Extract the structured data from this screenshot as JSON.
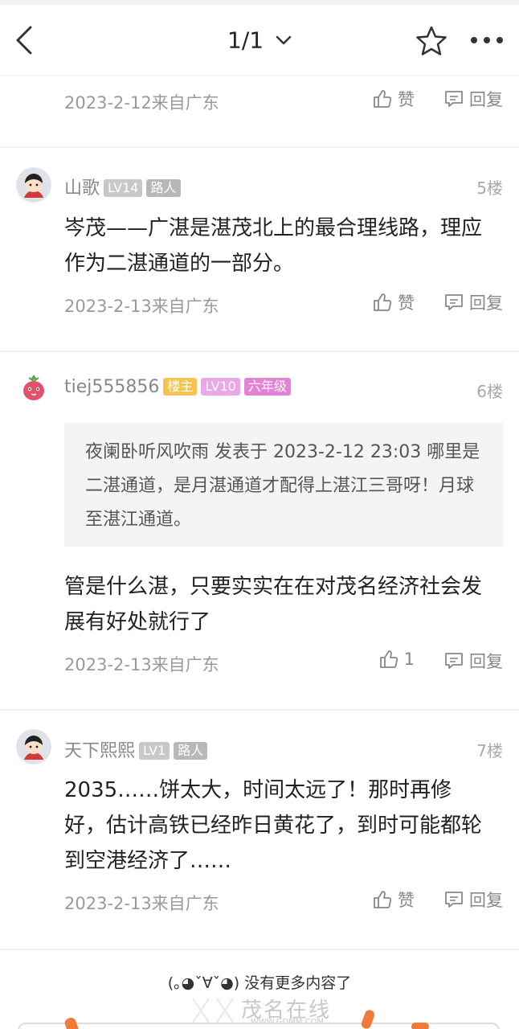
{
  "nav": {
    "page_indicator": "1/1"
  },
  "posts": [
    {
      "date": "2023-2-12来自广东",
      "like_label": "赞",
      "reply_label": "回复"
    },
    {
      "username": "山歌",
      "badges": [
        "LV14",
        "路人"
      ],
      "floor": "5楼",
      "content": "岑茂——广湛是湛茂北上的最合理线路，理应作为二湛通道的一部分。",
      "date": "2023-2-13来自广东",
      "like_label": "赞",
      "reply_label": "回复"
    },
    {
      "username": "tiej555856",
      "badges": [
        "楼主",
        "LV10",
        "六年级"
      ],
      "floor": "6楼",
      "quote": "夜阑卧听风吹雨 发表于 2023-2-12 23:03 哪里是二湛通道，是月湛通道才配得上湛江三哥呀！月球至湛江通道。",
      "content": "管是什么湛，只要实实在在对茂名经济社会发展有好处就行了",
      "date": "2023-2-13来自广东",
      "like_label": "1",
      "reply_label": "回复"
    },
    {
      "username": "天下熙熙",
      "badges": [
        "LV1",
        "路人"
      ],
      "floor": "7楼",
      "content": "2035……饼太大，时间太远了！那时再修好，估计高铁已经昨日黄花了，到时可能都轮到空港经济了……",
      "date": "2023-2-13来自广东",
      "like_label": "赞",
      "reply_label": "回复"
    }
  ],
  "footer": {
    "end_text": "(｡◕ˇ∀ˇ◕) 没有更多内容了",
    "watermark_text": "茂名在线",
    "watermark_url": "WWW.GDMM.COM"
  },
  "colors": {
    "badge_host": "#f5c453",
    "badge_lv10": "#e9a8e6",
    "badge_grade": "#e284d6",
    "deco_orange": "#f07a3a"
  },
  "icons": [
    "back-arrow-icon",
    "chevron-down-icon",
    "star-icon",
    "more-dots-icon",
    "thumbs-up-icon",
    "reply-bubble-icon",
    "avatar-boy-icon",
    "avatar-fruit-icon"
  ]
}
